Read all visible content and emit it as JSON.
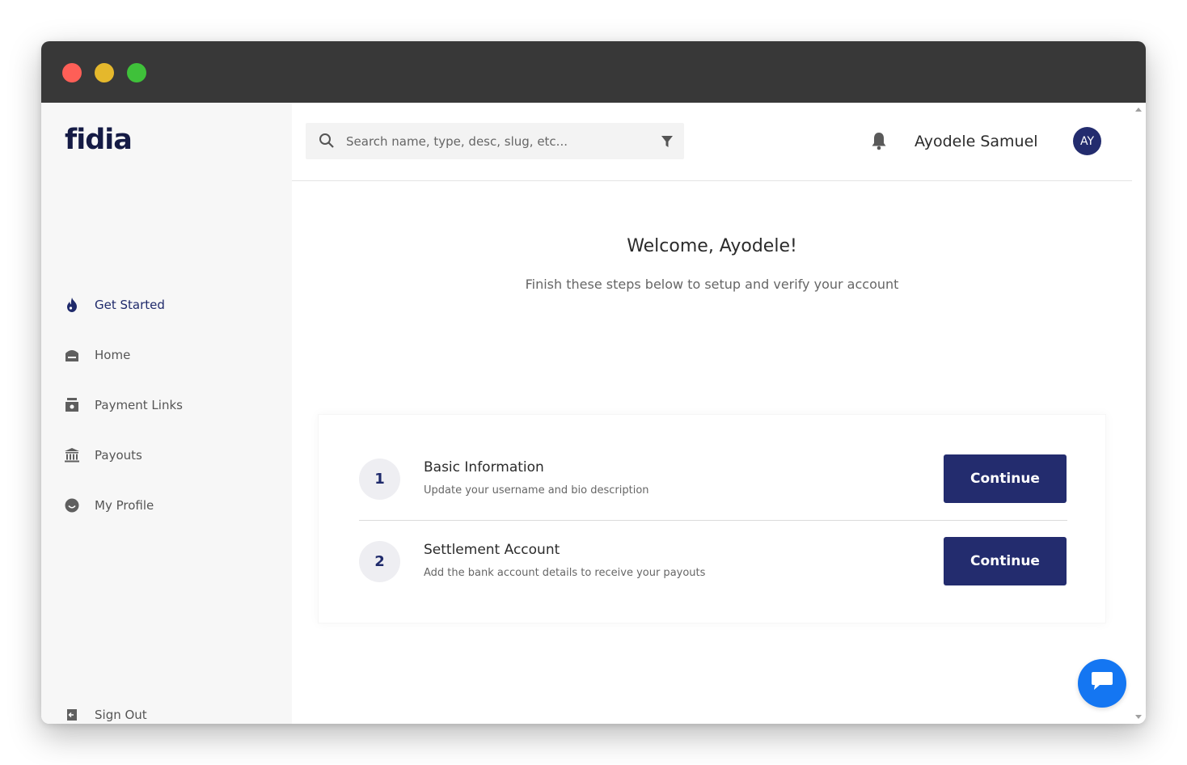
{
  "app": {
    "logo_text": "fidia",
    "brand_color": "#232c6e",
    "accent_color": "#1476f2"
  },
  "window": {
    "controls": [
      "close",
      "minimize",
      "maximize"
    ]
  },
  "sidebar": {
    "items": [
      {
        "label": "Get Started",
        "icon": "flame-icon",
        "active": true
      },
      {
        "label": "Home",
        "icon": "home-icon",
        "active": false
      },
      {
        "label": "Payment Links",
        "icon": "cash-register-icon",
        "active": false
      },
      {
        "label": "Payouts",
        "icon": "bank-icon",
        "active": false
      },
      {
        "label": "My Profile",
        "icon": "smiley-icon",
        "active": false
      }
    ],
    "sign_out": {
      "label": "Sign Out",
      "icon": "sign-out-icon"
    }
  },
  "header": {
    "search_placeholder": "Search name, type, desc, slug, etc...",
    "user_name": "Ayodele Samuel",
    "avatar_initials": "AY"
  },
  "main": {
    "welcome": "Welcome, Ayodele!",
    "subtitle": "Finish these steps below to setup and verify your account",
    "steps": [
      {
        "number": "1",
        "title": "Basic Information",
        "description": "Update your username and bio description",
        "button": "Continue"
      },
      {
        "number": "2",
        "title": "Settlement Account",
        "description": "Add the bank account details to receive your payouts",
        "button": "Continue"
      }
    ]
  }
}
